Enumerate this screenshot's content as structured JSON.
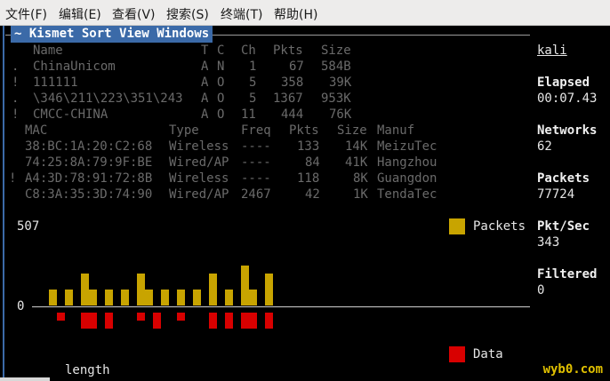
{
  "menubar": {
    "items": [
      "文件(F)",
      "编辑(E)",
      "查看(V)",
      "搜索(S)",
      "终端(T)",
      "帮助(H)"
    ]
  },
  "kismet": {
    "title_prefix": "~ ",
    "menu": [
      "Kismet",
      "Sort",
      "View",
      "Windows"
    ],
    "network_columns": {
      "name": "Name",
      "t": "T",
      "c": "C",
      "ch": "Ch",
      "pkts": "Pkts",
      "size": "Size"
    },
    "networks": [
      {
        "flag": ".",
        "name": "ChinaUnicom",
        "t": "A",
        "c": "N",
        "ch": "1",
        "pkts": "67",
        "size": "584B"
      },
      {
        "flag": "!",
        "name": "111111",
        "t": "A",
        "c": "O",
        "ch": "5",
        "pkts": "358",
        "size": "39K"
      },
      {
        "flag": ".",
        "name": "\\346\\211\\223\\351\\243",
        "t": "A",
        "c": "O",
        "ch": "5",
        "pkts": "1367",
        "size": "953K"
      },
      {
        "flag": "!",
        "name": "CMCC-CHINA",
        "t": "A",
        "c": "O",
        "ch": "11",
        "pkts": "444",
        "size": "76K"
      }
    ],
    "client_columns": {
      "mac": "MAC",
      "type": "Type",
      "freq": "Freq",
      "pkts": "Pkts",
      "size": "Size",
      "manuf": "Manuf"
    },
    "clients": [
      {
        "flag": "",
        "mac": "38:BC:1A:20:C2:68",
        "type": "Wireless",
        "freq": "----",
        "pkts": "133",
        "size": "14K",
        "manuf": "MeizuTec"
      },
      {
        "flag": "",
        "mac": "74:25:8A:79:9F:BE",
        "type": "Wired/AP",
        "freq": "----",
        "pkts": "84",
        "size": "41K",
        "manuf": "Hangzhou"
      },
      {
        "flag": "!",
        "mac": "A4:3D:78:91:72:8B",
        "type": "Wireless",
        "freq": "----",
        "pkts": "118",
        "size": "8K",
        "manuf": "Guangdon"
      },
      {
        "flag": "",
        "mac": "C8:3A:35:3D:74:90",
        "type": "Wired/AP",
        "freq": "2467",
        "pkts": "42",
        "size": "1K",
        "manuf": "TendaTec"
      }
    ],
    "graph": {
      "ymax_label": "507",
      "zero_label": "0",
      "legend_packets": "Packets",
      "legend_data": "Data",
      "xlabel": "length",
      "packet_color": "#c8a400",
      "data_color": "#d80000"
    },
    "sidebar": {
      "host": "kali",
      "elapsed_label": "Elapsed",
      "elapsed_value": "00:07.43",
      "networks_label": "Networks",
      "networks_value": "62",
      "packets_label": "Packets",
      "packets_value": "77724",
      "pktsec_label": "Pkt/Sec",
      "pktsec_value": "343",
      "filtered_label": "Filtered",
      "filtered_value": "0"
    }
  },
  "watermark": "wyb0.com",
  "chart_data": {
    "type": "bar",
    "ymax": 507,
    "series": [
      {
        "name": "Packets",
        "values": [
          2,
          0,
          2,
          0,
          4,
          2,
          0,
          2,
          0,
          2,
          0,
          4,
          2,
          0,
          2,
          0,
          2,
          0,
          2,
          0,
          4,
          0,
          2,
          0,
          5,
          2,
          0,
          4
        ]
      },
      {
        "name": "Data",
        "values": [
          0,
          1,
          0,
          0,
          2,
          2,
          0,
          2,
          0,
          0,
          0,
          1,
          0,
          2,
          0,
          0,
          1,
          0,
          0,
          0,
          2,
          0,
          2,
          0,
          2,
          2,
          0,
          2
        ]
      }
    ]
  }
}
